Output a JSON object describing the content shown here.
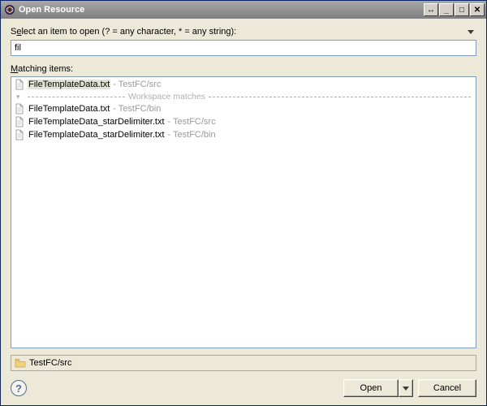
{
  "title": "Open Resource",
  "prompt_pre": "S",
  "prompt_u": "e",
  "prompt_post": "lect an item to open (? = any character, * = any string):",
  "search_value": "fil",
  "matching_pre": "",
  "matching_u": "M",
  "matching_post": "atching items:",
  "separator_label": "Workspace matches",
  "items": [
    {
      "name": "FileTemplateData.txt",
      "path": " - TestFC/src",
      "selected": true
    },
    {
      "name": "FileTemplateData.txt",
      "path": " - TestFC/bin",
      "selected": false
    },
    {
      "name": "FileTemplateData_starDelimiter.txt",
      "path": " - TestFC/src",
      "selected": false
    },
    {
      "name": "FileTemplateData_starDelimiter.txt",
      "path": " - TestFC/bin",
      "selected": false
    }
  ],
  "status_path": "TestFC/src",
  "open_label": "Open",
  "cancel_label": "Cancel",
  "titlebar_buttons": {
    "b1": "↔",
    "b2": "_",
    "b3": "□",
    "b4": "✕"
  }
}
